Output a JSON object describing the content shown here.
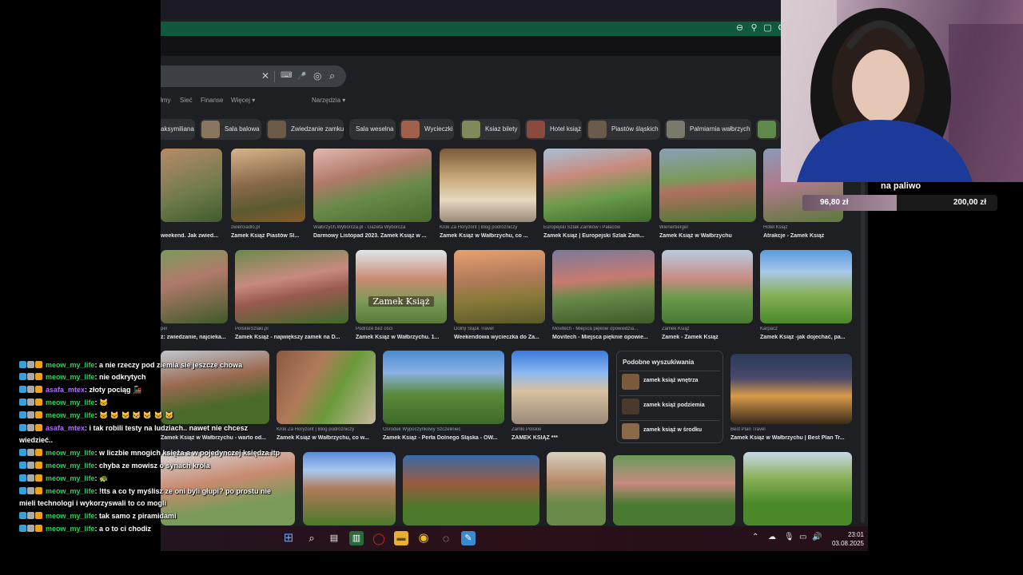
{
  "search": {
    "clear": "✕",
    "keyboard": "⌨",
    "mic": "🎤",
    "lens": "◎",
    "search": "⌕"
  },
  "tabs": [
    "łmy",
    "Sieć",
    "Finanse",
    "Więcej ▾",
    "Narzędzia ▾"
  ],
  "chips": [
    "aksymiliana",
    "Sala balowa",
    "Zwiedzanie zamku",
    "Sala weselna",
    "Wycieczki",
    "Ksiaz bilety",
    "Hotel książ",
    "Piastów śląskich",
    "Palmiarnia wałbrzych"
  ],
  "row1": [
    {
      "src": "",
      "cap": "weekend. Jak zwied..."
    },
    {
      "src": "zwierciadlo.pl",
      "cap": "Zamek Książ Piastów Śl..."
    },
    {
      "src": "Wałbrzych.Wyborcza.pl - Gazeta Wyborcza",
      "cap": "Darmowy Listopad 2023. Zamek Książ w ..."
    },
    {
      "src": "Krok Za Horyzont | Blog podróżniczy",
      "cap": "Zamek Książ w Wałbrzychu, co ..."
    },
    {
      "src": "Europejski Szlak Zamków i Pałaców",
      "cap": "Zamek Książ | Europejski Szlak Zam..."
    },
    {
      "src": "Wienerberger",
      "cap": "Zamek Książ w Wałbrzychu"
    },
    {
      "src": "Hotel Książ",
      "cap": "Atrakcje - Zamek Książ"
    }
  ],
  "row2": [
    {
      "src": "pel",
      "cap": "ż: zwiedzanie, najcieka..."
    },
    {
      "src": "PolskieSzlaki.pl",
      "cap": "Zamek Książ - największy zamek na D..."
    },
    {
      "src": "Podróże bez ości",
      "cap": "Zamek Książ w Wałbrzychu. 1..."
    },
    {
      "src": "Dolny Śląsk Travel",
      "cap": "Weekendowa wycieczka do Za..."
    },
    {
      "src": "Movitech - Miejsca pięknie opowiedzia...",
      "cap": "Movitech - Miejsca pięknie opowie..."
    },
    {
      "src": "Zamek Książ",
      "cap": "Zamek - Zamek Książ"
    },
    {
      "src": "Karpacz",
      "cap": "Zamek Książ -jak dojechać, pa..."
    }
  ],
  "row3": [
    {
      "src": "",
      "cap": "Zamek Książ w Wałbrzychu - warto od..."
    },
    {
      "src": "Krok Za Horyzont | Blog podróżniczy",
      "cap": "Zamek Książ w Wałbrzychu, co w..."
    },
    {
      "src": "Ośrodek Wypoczynkowy Szczeliniec",
      "cap": "Zamek Książ - Perła Dolnego Śląska - OW..."
    },
    {
      "src": "Zamki Polskie",
      "cap": "ZAMEK KSIĄŻ ***"
    },
    {
      "src": "Best Plan Travel",
      "cap": "Zamek Książ w Wałbrzychu | Best Plan Tr..."
    }
  ],
  "zamek_caption": "Zamek Książ",
  "related": {
    "title": "Podobne wyszukiwania",
    "items": [
      "zamek książ wnętrza",
      "zamek książ podziemia",
      "zamek książ w środku"
    ]
  },
  "clock": {
    "time": "23:01",
    "date": "03.08.2025"
  },
  "goal": {
    "label": "na paliwo",
    "current": "96,80 zł",
    "target": "200,00 zł",
    "fraction": 0.484
  },
  "chat": [
    {
      "user": "meow_my_life",
      "text": ": a nie rzeczy pod ziemia sie jeszcze chowa",
      "purple": false
    },
    {
      "user": "meow_my_life",
      "text": ": nie odkrytych",
      "purple": false
    },
    {
      "user": "asafa_mtex",
      "text": ": złoty pociąg 🚂",
      "purple": true
    },
    {
      "user": "meow_my_life",
      "text": ": 🐱",
      "purple": false
    },
    {
      "user": "meow_my_life",
      "text": ": 🐱 🐱 🐱 🐱 🐱 🐱 🐱",
      "purple": false
    },
    {
      "user": "asafa_mtex",
      "text": ": i tak robili testy na ludziach.. nawet nie chcesz wiedzieć..",
      "purple": true
    },
    {
      "user": "meow_my_life",
      "text": ": w liczbie mnogich księża a w pojedynczej księdza itp",
      "purple": false
    },
    {
      "user": "meow_my_life",
      "text": ": chyba ze mowisz o synach króla",
      "purple": false
    },
    {
      "user": "meow_my_life",
      "text": ": 🐢",
      "purple": false
    },
    {
      "user": "meow_my_life",
      "text": ": !tts a co ty myślisz ze oni byli głupi? po prostu nie mieli technologi i wykorzyswali to co mogli",
      "purple": false
    },
    {
      "user": "meow_my_life",
      "text": ": tak samo z piramidami",
      "purple": false
    },
    {
      "user": "meow_my_life",
      "text": ": a o to ci chodiz",
      "purple": false
    }
  ]
}
